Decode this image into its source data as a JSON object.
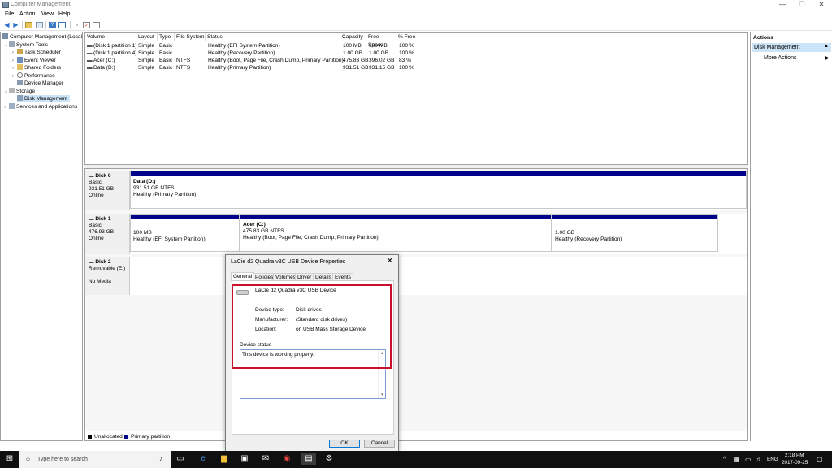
{
  "window": {
    "title": "Computer Management",
    "minimize": "—",
    "maximize": "❐",
    "close": "✕"
  },
  "menu": [
    "File",
    "Action",
    "View",
    "Help"
  ],
  "tree": [
    {
      "label": "Computer Management (Local",
      "depth": 0
    },
    {
      "label": "System Tools",
      "depth": 1
    },
    {
      "label": "Task Scheduler",
      "depth": 2
    },
    {
      "label": "Event Viewer",
      "depth": 2
    },
    {
      "label": "Shared Folders",
      "depth": 2
    },
    {
      "label": "Performance",
      "depth": 2
    },
    {
      "label": "Device Manager",
      "depth": 2
    },
    {
      "label": "Storage",
      "depth": 1
    },
    {
      "label": "Disk Management",
      "depth": 2
    },
    {
      "label": "Services and Applications",
      "depth": 1
    }
  ],
  "volumes": {
    "headers": [
      "Volume",
      "Layout",
      "Type",
      "File System",
      "Status",
      "Capacity",
      "Free Space",
      "% Free"
    ],
    "rows": [
      [
        "(Disk 1 partition 1)",
        "Simple",
        "Basic",
        "",
        "Healthy (EFI System Partition)",
        "100 MB",
        "100 MB",
        "100 %"
      ],
      [
        "(Disk 1 partition 4)",
        "Simple",
        "Basic",
        "",
        "Healthy (Recovery Partition)",
        "1.00 GB",
        "1.00 GB",
        "100 %"
      ],
      [
        "Acer (C:)",
        "Simple",
        "Basic",
        "NTFS",
        "Healthy (Boot, Page File, Crash Dump, Primary Partition)",
        "475.83 GB",
        "396.02 GB",
        "83 %"
      ],
      [
        "Data (D:)",
        "Simple",
        "Basic",
        "NTFS",
        "Healthy (Primary Partition)",
        "931.51 GB",
        "931.15 GB",
        "100 %"
      ]
    ]
  },
  "disks": {
    "disk0": {
      "name": "Disk 0",
      "type": "Basic",
      "size": "931.51 GB",
      "state": "Online",
      "p1": {
        "name": "Data (D:)",
        "size": "931.51 GB NTFS",
        "status": "Healthy (Primary Partition)"
      }
    },
    "disk1": {
      "name": "Disk 1",
      "type": "Basic",
      "size": "476.93 GB",
      "state": "Online",
      "p1": {
        "size": "100 MB",
        "status": "Healthy (EFI System Partition)"
      },
      "p2": {
        "name": "Acer (C:)",
        "size": "475.83 GB NTFS",
        "status": "Healthy (Boot, Page File, Crash Dump, Primary Partition)"
      },
      "p3": {
        "size": "1.00 GB",
        "status": "Healthy (Recovery Partition)"
      }
    },
    "disk2": {
      "name": "Disk 2",
      "type": "Removable (E:)",
      "state": "No Media"
    }
  },
  "legend": {
    "unallocated": "Unallocated",
    "primary": "Primary partition"
  },
  "actions": {
    "header": "Actions",
    "section": "Disk Management",
    "more": "More Actions"
  },
  "dialog": {
    "title": "LaCie d2 Quadra v3C USB Device Properties",
    "tabs": [
      "General",
      "Policies",
      "Volumes",
      "Driver",
      "Details",
      "Events"
    ],
    "device_name": "LaCie d2 Quadra v3C USB Device",
    "device_type_label": "Device type:",
    "device_type": "Disk drives",
    "manufacturer_label": "Manufacturer:",
    "manufacturer": "(Standard disk drives)",
    "location_label": "Location:",
    "location": "on USB Mass Storage Device",
    "status_label": "Device status",
    "status_text": "This device is working properly.",
    "ok": "OK",
    "cancel": "Cancel"
  },
  "taskbar": {
    "search_placeholder": "Type here to search",
    "lang": "ENG",
    "time": "2:18 PM",
    "date": "2017-09-25"
  },
  "colors": {
    "partition_bar": "#00008b",
    "highlight": "#c8102e",
    "taskbar": "#101010"
  }
}
